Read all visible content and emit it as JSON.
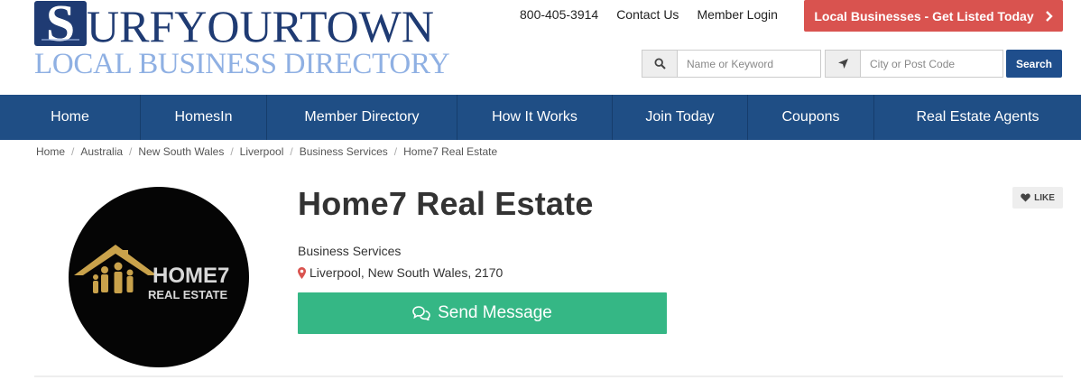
{
  "brand": {
    "logo_initial": "S",
    "logo_rest": "URFYOURTOWN",
    "logo_tagline": "LOCAL BUSINESS DIRECTORY"
  },
  "top_links": {
    "phone": "800-405-3914",
    "contact": "Contact Us",
    "login": "Member Login"
  },
  "cta": {
    "label": "Local Businesses - Get Listed Today",
    "icon": "chevron-right-icon",
    "color": "#d9534f"
  },
  "search": {
    "keyword_placeholder": "Name or Keyword",
    "city_placeholder": "City or Post Code",
    "button_label": "Search",
    "keyword_icon": "search-icon",
    "location_icon": "location-arrow-icon"
  },
  "nav": {
    "items": [
      {
        "label": "Home"
      },
      {
        "label": "HomesIn"
      },
      {
        "label": "Member Directory"
      },
      {
        "label": "How It Works"
      },
      {
        "label": "Join Today"
      },
      {
        "label": "Coupons"
      },
      {
        "label": "Real Estate Agents"
      }
    ],
    "color": "#1f4e85"
  },
  "breadcrumb": [
    "Home",
    "Australia",
    "New South Wales",
    "Liverpool",
    "Business Services",
    "Home7 Real Estate"
  ],
  "listing": {
    "title": "Home7 Real Estate",
    "category": "Business Services",
    "location": "Liverpool, New South Wales, 2170",
    "send_message_label": "Send Message",
    "like_label": "LIKE",
    "logo_text_line1": "HOME7",
    "logo_text_line2": "REAL ESTATE",
    "accent": "#35b785"
  }
}
